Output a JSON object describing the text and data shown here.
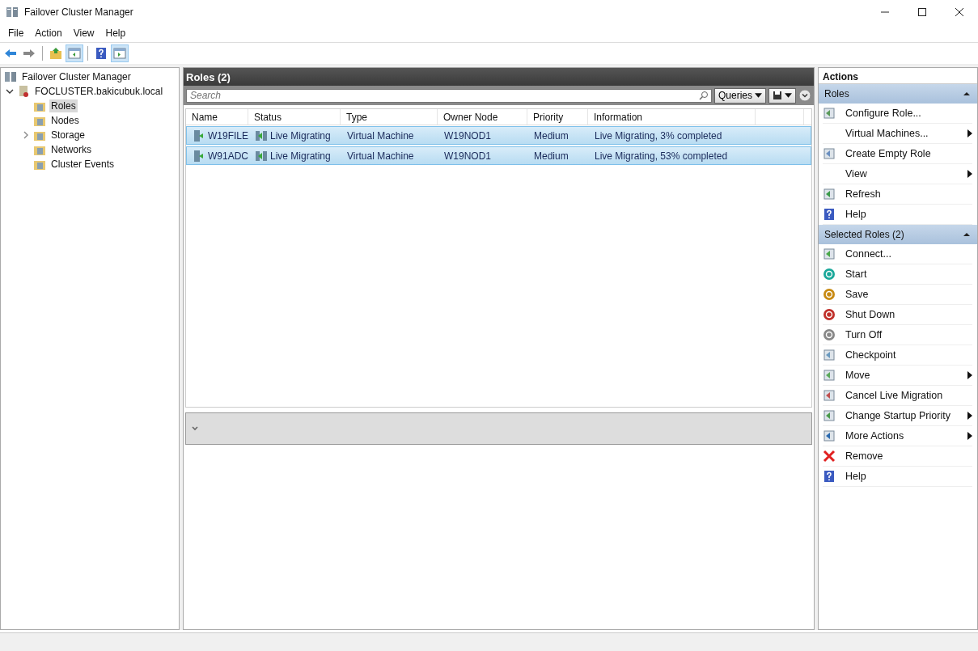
{
  "window": {
    "title": "Failover Cluster Manager"
  },
  "menu": [
    "File",
    "Action",
    "View",
    "Help"
  ],
  "tree": {
    "label": "Failover Cluster Manager",
    "children": [
      {
        "label": "FOCLUSTER.bakicubuk.local",
        "expanded": true,
        "children": [
          {
            "label": "Roles",
            "selected": true,
            "expandable": false
          },
          {
            "label": "Nodes",
            "selected": false,
            "expandable": false
          },
          {
            "label": "Storage",
            "selected": false,
            "expandable": true
          },
          {
            "label": "Networks",
            "selected": false,
            "expandable": false
          },
          {
            "label": "Cluster Events",
            "selected": false,
            "expandable": false
          }
        ]
      }
    ]
  },
  "roles": {
    "title": "Roles (2)",
    "search": {
      "placeholder": "Search"
    },
    "queries": "Queries",
    "columns": [
      "Name",
      "Status",
      "Type",
      "Owner Node",
      "Priority",
      "Information"
    ],
    "rows": [
      {
        "name": "W19FILE",
        "status": "Live Migrating",
        "type": "Virtual Machine",
        "owner": "W19NOD1",
        "priority": "Medium",
        "information": "Live Migrating, 3% completed",
        "selected": true
      },
      {
        "name": "W91ADC",
        "status": "Live Migrating",
        "type": "Virtual Machine",
        "owner": "W19NOD1",
        "priority": "Medium",
        "information": "Live Migrating, 53% completed",
        "selected": true
      }
    ]
  },
  "actions": {
    "title": "Actions",
    "sections": [
      {
        "title": "Roles",
        "expanded": true,
        "items": [
          {
            "label": "Configure Role...",
            "submenu": false
          },
          {
            "label": "Virtual Machines...",
            "submenu": true
          },
          {
            "label": "Create Empty Role",
            "submenu": false
          },
          {
            "label": "View",
            "submenu": true
          },
          {
            "label": "Refresh",
            "submenu": false
          },
          {
            "label": "Help",
            "submenu": false
          }
        ]
      },
      {
        "title": "Selected Roles (2)",
        "expanded": true,
        "items": [
          {
            "label": "Connect...",
            "submenu": false
          },
          {
            "label": "Start",
            "submenu": false
          },
          {
            "label": "Save",
            "submenu": false
          },
          {
            "label": "Shut Down",
            "submenu": false
          },
          {
            "label": "Turn Off",
            "submenu": false
          },
          {
            "label": "Checkpoint",
            "submenu": false
          },
          {
            "label": "Move",
            "submenu": true
          },
          {
            "label": "Cancel Live Migration",
            "submenu": false
          },
          {
            "label": "Change Startup Priority",
            "submenu": true
          },
          {
            "label": "More Actions",
            "submenu": true
          },
          {
            "label": "Remove",
            "submenu": false
          },
          {
            "label": "Help",
            "submenu": false
          }
        ]
      }
    ]
  }
}
